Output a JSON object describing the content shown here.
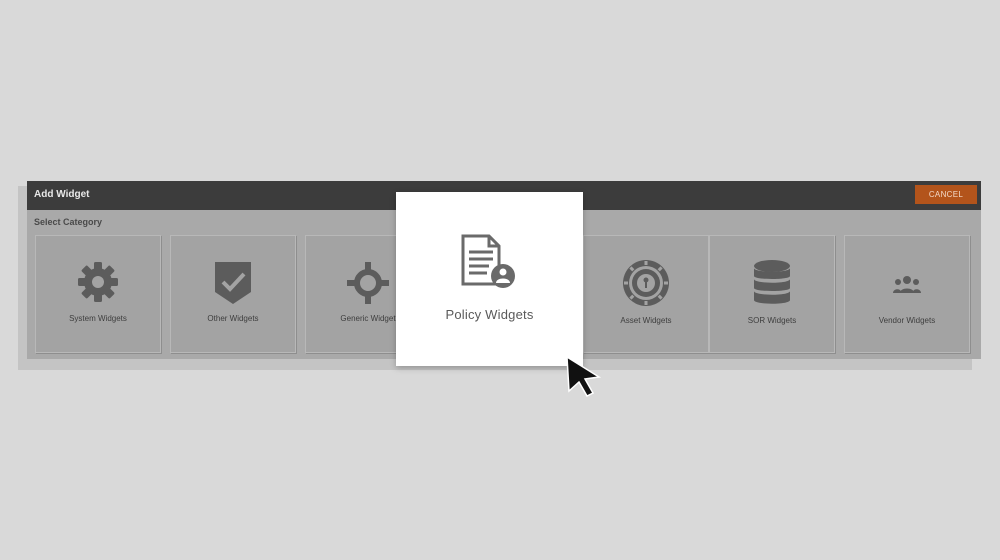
{
  "dialog": {
    "title": "Add Widget",
    "cancel_label": "CANCEL",
    "section_label": "Select Category"
  },
  "tiles": [
    {
      "label": "System Widgets",
      "icon": "gear-icon"
    },
    {
      "label": "Other Widgets",
      "icon": "badge-check-icon"
    },
    {
      "label": "Generic Widget",
      "icon": "crosshair-icon"
    },
    {
      "label": "Asset Widgets",
      "icon": "safe-dial-icon"
    },
    {
      "label": "SOR Widgets",
      "icon": "database-icon"
    },
    {
      "label": "Vendor Widgets",
      "icon": "users-icon"
    }
  ],
  "highlight": {
    "label": "Policy Widgets",
    "icon": "policy-document-icon"
  },
  "colors": {
    "header": "#3c3c3c",
    "cancel": "#b3541b",
    "icon": "#5c5c5c"
  }
}
